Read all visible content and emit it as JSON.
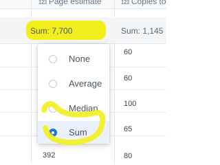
{
  "header": {
    "col1": {
      "type": "123",
      "label": "Page estimate"
    },
    "col2": {
      "type": "123",
      "label": "Copies to"
    }
  },
  "summary": {
    "col1": "Sum: 7,700",
    "col2": "Sum: 1,145"
  },
  "rows": {
    "col2": [
      "60",
      "60",
      "100",
      "65",
      "80"
    ],
    "col1_visible": "392"
  },
  "aggregate_menu": {
    "options": [
      "None",
      "Average",
      "Median",
      "Sum"
    ],
    "selected": "Sum"
  },
  "colors": {
    "highlight": "#f2ef1d",
    "accent": "#1a73e8"
  }
}
